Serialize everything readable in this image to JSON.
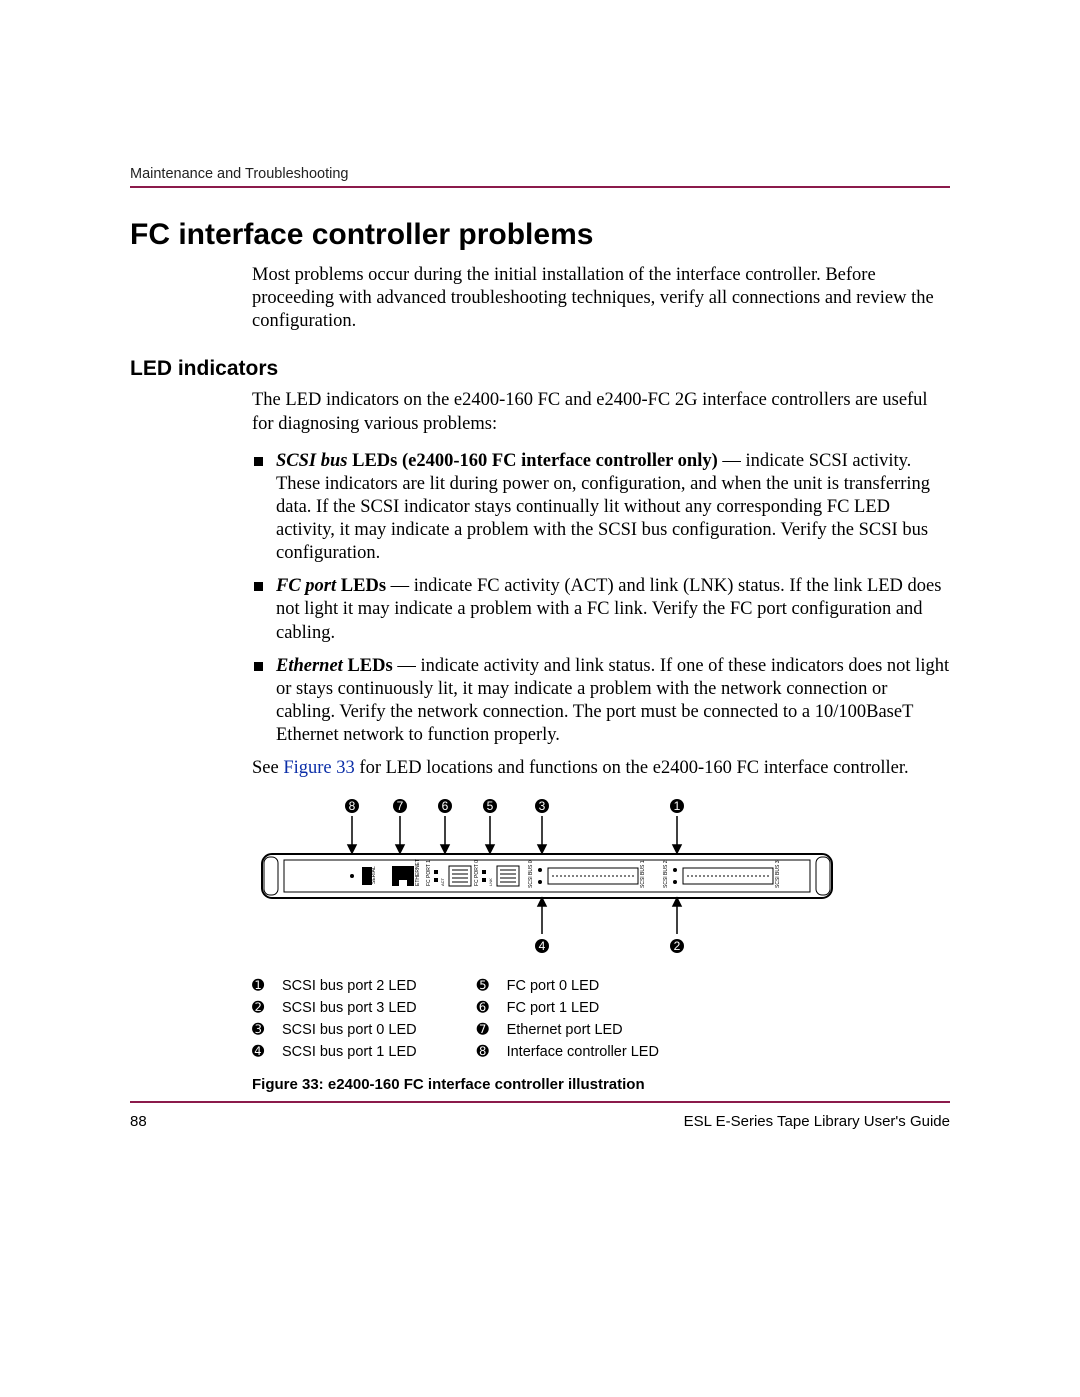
{
  "header": {
    "running_head": "Maintenance and Troubleshooting"
  },
  "section": {
    "title": "FC interface controller problems",
    "intro": "Most problems occur during the initial installation of the interface controller. Before proceeding with advanced troubleshooting techniques, verify all connections and review the configuration."
  },
  "led": {
    "heading": "LED indicators",
    "para1": "The LED indicators on the e2400-160 FC and e2400-FC 2G interface controllers are useful for diagnosing various problems:",
    "bullets": {
      "b1": {
        "lead_bi": "SCSI bus",
        "lead_b": " LEDs (e2400-160 FC interface controller only)",
        "rest": " — indicate SCSI activity. These indicators are lit during power on, configuration, and when the unit is transferring data. If the SCSI indicator stays continually lit without any corresponding FC LED activity, it may indicate a problem with the SCSI bus configuration. Verify the SCSI bus configuration."
      },
      "b2": {
        "lead_bi": "FC port",
        "lead_b": " LEDs",
        "rest": " — indicate FC activity (ACT) and link (LNK) status. If the link LED does not light it may indicate a problem with a FC link. Verify the FC port configuration and cabling."
      },
      "b3": {
        "lead_bi": "Ethernet",
        "lead_b": " LEDs",
        "rest": " — indicate activity and link status. If one of these indicators does not light or stays continuously lit, it may indicate a problem with the network connection or cabling. Verify the network connection. The port must be connected to a 10/100BaseT Ethernet network to function properly."
      }
    },
    "see_pre": "See ",
    "see_link": "Figure 33",
    "see_post": " for LED locations and functions on the e2400-160 FC interface controller."
  },
  "figure": {
    "caption": "Figure 33:  e2400-160 FC interface controller illustration",
    "labels_top": {
      "d8": "8",
      "d7": "7",
      "d6": "6",
      "d5": "5",
      "d3": "3",
      "d1": "1"
    },
    "labels_bot": {
      "d4": "4",
      "d2": "2"
    },
    "panel_text": {
      "serial": "SERIAL",
      "ethernet": "ETHERNET",
      "fc0": "FC PORT 0",
      "fc1": "FC PORT 1",
      "act": "ACT",
      "lnk": "LNK",
      "scsi0": "SCSI BUS 0",
      "scsi1": "SCSI BUS 1",
      "scsi2": "SCSI BUS 2",
      "scsi3": "SCSI BUS 3"
    },
    "legend": {
      "left": [
        {
          "n": "1",
          "t": "SCSI bus port 2 LED"
        },
        {
          "n": "2",
          "t": "SCSI bus port 3 LED"
        },
        {
          "n": "3",
          "t": "SCSI bus port 0 LED"
        },
        {
          "n": "4",
          "t": "SCSI bus port 1 LED"
        }
      ],
      "right": [
        {
          "n": "5",
          "t": "FC port 0 LED"
        },
        {
          "n": "6",
          "t": "FC port 1 LED"
        },
        {
          "n": "7",
          "t": "Ethernet port LED"
        },
        {
          "n": "8",
          "t": "Interface controller LED"
        }
      ]
    },
    "dingbat": {
      "1": "➊",
      "2": "➋",
      "3": "➌",
      "4": "➍",
      "5": "➎",
      "6": "➏",
      "7": "➐",
      "8": "➑"
    }
  },
  "footer": {
    "page_no": "88",
    "doc_title": "ESL E-Series Tape Library User's Guide"
  }
}
